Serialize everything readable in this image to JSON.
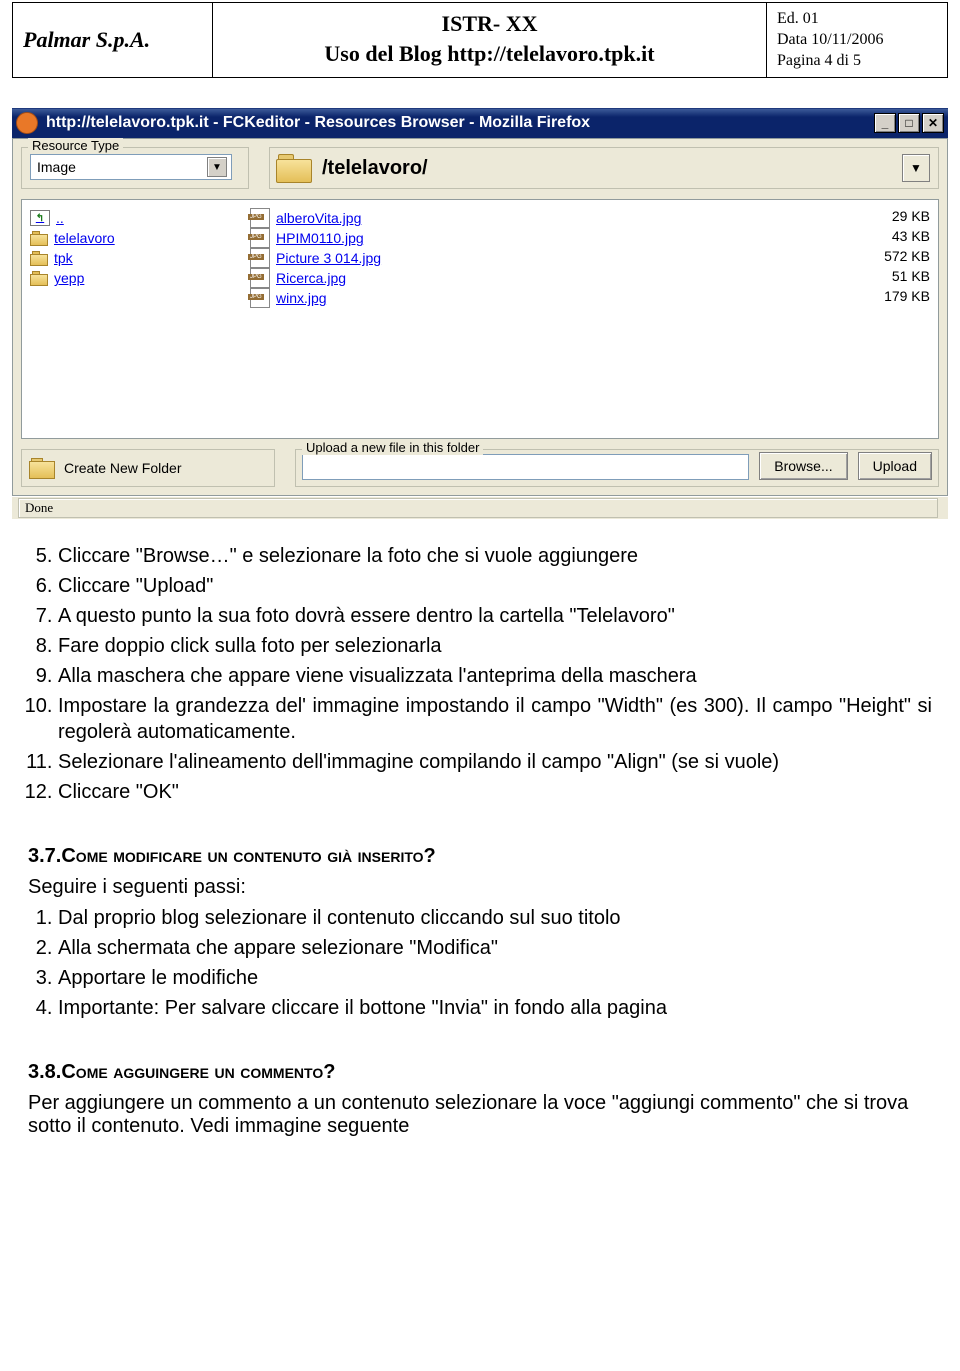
{
  "header": {
    "company": "Palmar S.p.A.",
    "code": "ISTR- XX",
    "subtitle": "Uso del Blog http://telelavoro.tpk.it",
    "meta_ed": "Ed. 01",
    "meta_date": "Data 10/11/2006",
    "meta_page": "Pagina 4 di 5"
  },
  "browser": {
    "title": "http://telelavoro.tpk.it - FCKeditor - Resources Browser - Mozilla Firefox",
    "resource_type_label": "Resource Type",
    "resource_type_value": "Image",
    "breadcrumb": "/telelavoro/",
    "folder_up_label": "..",
    "folders": [
      "telelavoro",
      "tpk",
      "yepp"
    ],
    "files": [
      {
        "name": "alberoVita.jpg",
        "size": "29 KB"
      },
      {
        "name": "HPIM0110.jpg",
        "size": "43 KB"
      },
      {
        "name": "Picture 3 014.jpg",
        "size": "572 KB"
      },
      {
        "name": "Ricerca.jpg",
        "size": "51 KB"
      },
      {
        "name": "winx.jpg",
        "size": "179 KB"
      }
    ],
    "create_folder_label": "Create New Folder",
    "upload_legend": "Upload a new file in this folder",
    "browse_button": "Browse...",
    "upload_button": "Upload",
    "status": "Done"
  },
  "steps_a": {
    "s5": "Cliccare \"Browse…\" e selezionare la foto che si vuole aggiungere",
    "s6": "Cliccare \"Upload\"",
    "s7": "A questo punto la sua foto dovrà essere dentro la cartella \"Telelavoro\"",
    "s8": "Fare doppio click sulla foto per selezionarla",
    "s9": "Alla maschera che appare viene visualizzata l'anteprima della maschera",
    "s10": "Impostare la grandezza del' immagine impostando il campo \"Width\" (es 300). Il campo \"Height\" si regolerà automaticamente.",
    "s11": "Selezionare l'alineamento dell'immagine compilando il campo \"Align\" (se si vuole)",
    "s12": "Cliccare \"OK\""
  },
  "section37": {
    "num": "3.7.",
    "title": "Come modificare un contenuto già inserito?",
    "intro": "Seguire i seguenti passi:",
    "steps": {
      "s1": "Dal proprio blog selezionare il contenuto cliccando sul suo titolo",
      "s2": "Alla schermata che appare selezionare \"Modifica\"",
      "s3": "Apportare le modifiche",
      "s4": "Importante: Per salvare cliccare il bottone \"Invia\" in fondo alla pagina"
    }
  },
  "section38": {
    "num": "3.8.",
    "title": "Come agguingere un commento?",
    "body": "Per aggiungere un commento a un contenuto selezionare la voce \"aggiungi commento\" che si trova sotto il contenuto. Vedi immagine seguente"
  }
}
